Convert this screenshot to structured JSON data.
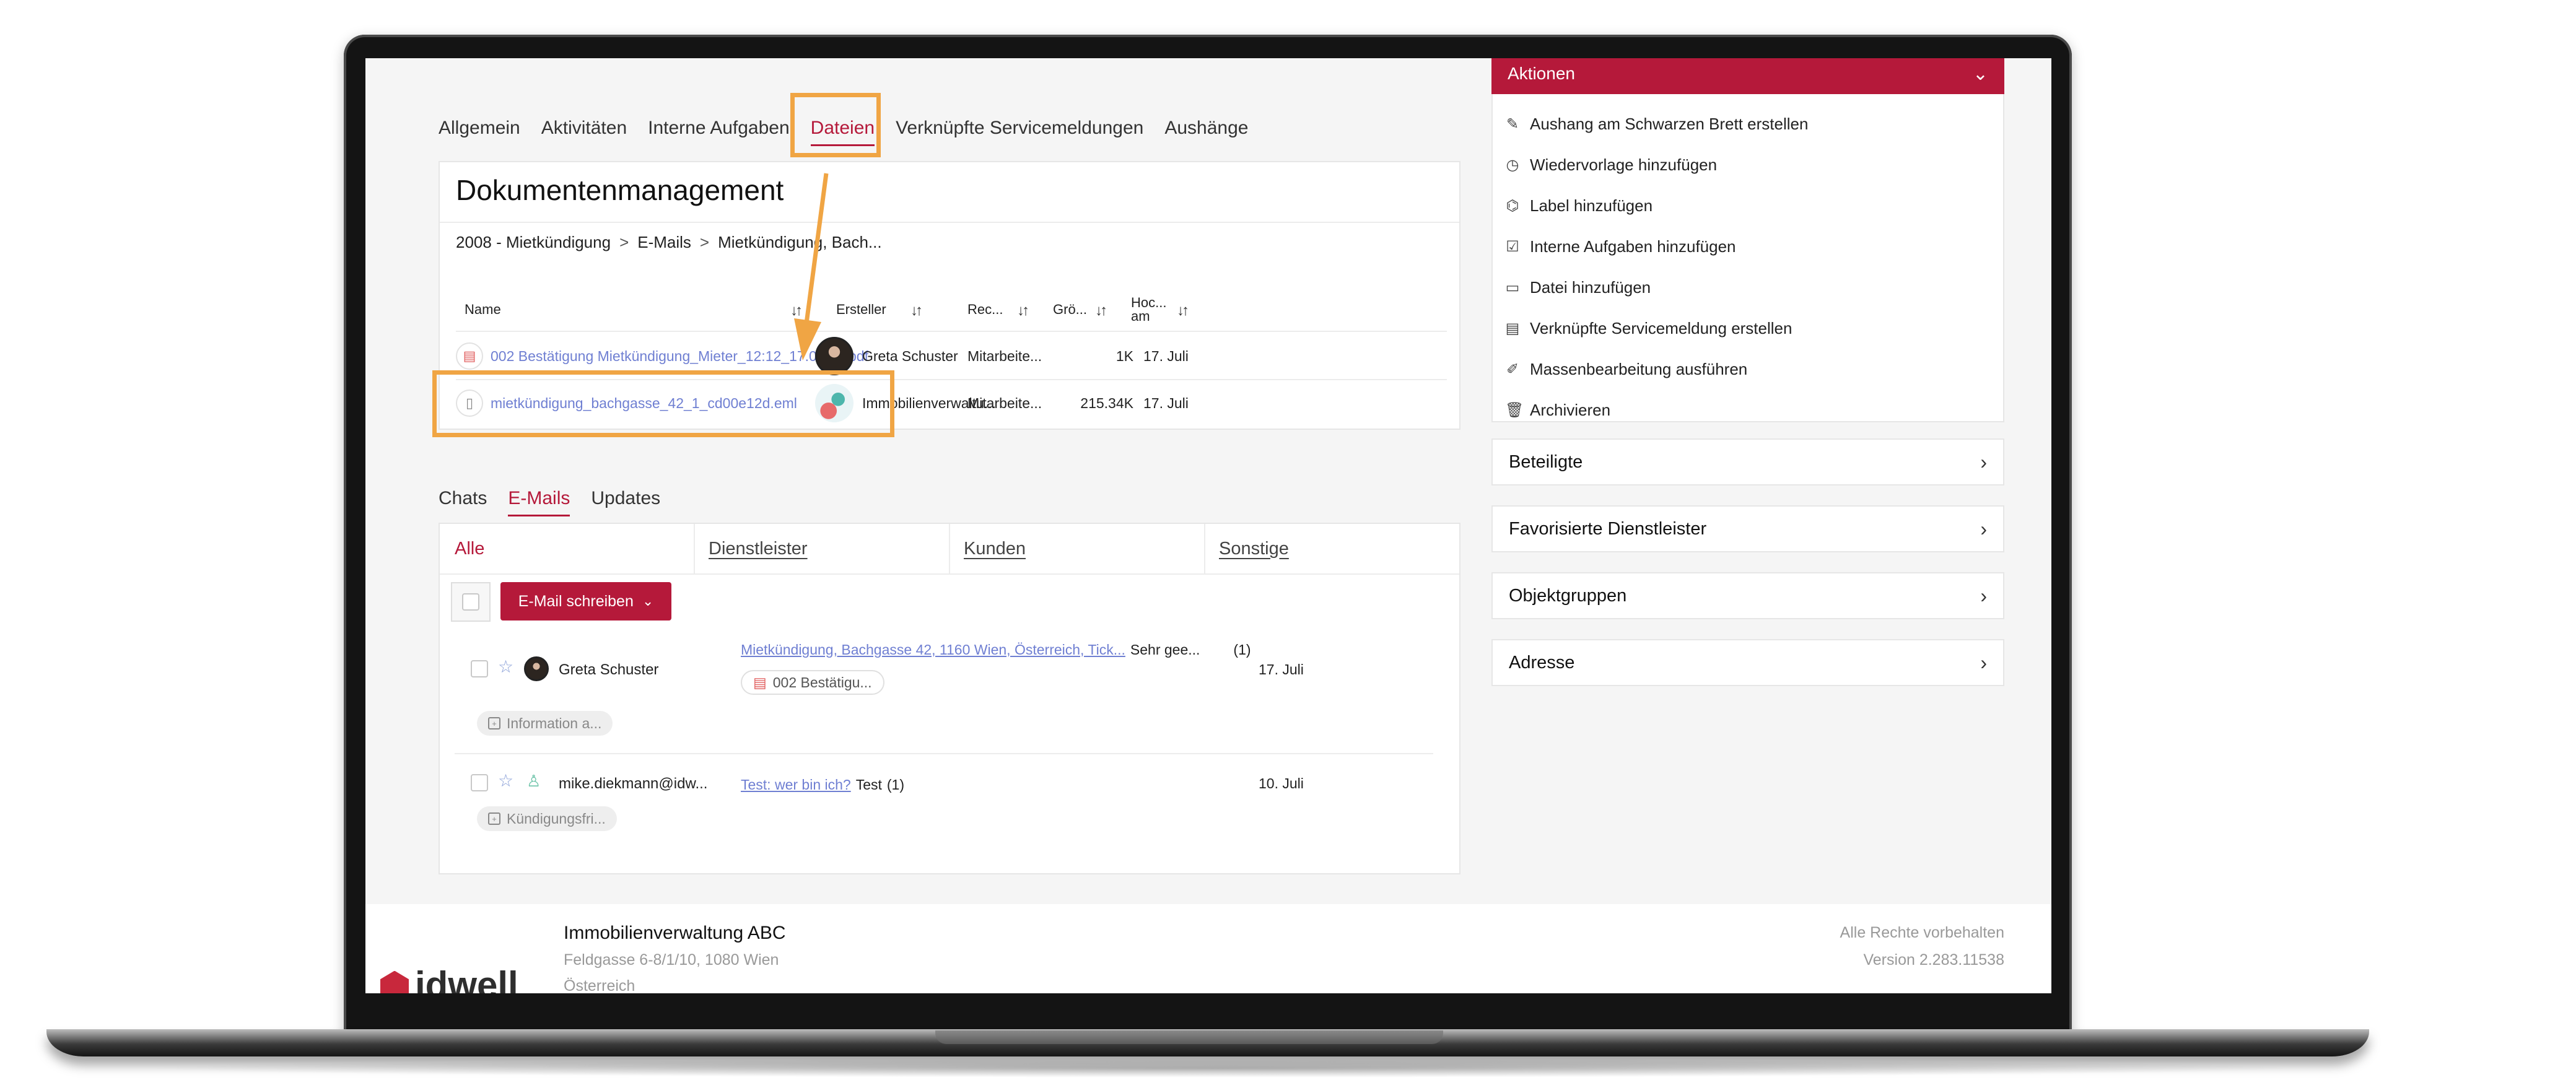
{
  "tabs": [
    "Allgemein",
    "Aktivitäten",
    "Interne Aufgaben",
    "Dateien",
    "Verknüpfte Servicemeldungen",
    "Aushänge"
  ],
  "active_tab": "Dateien",
  "documents": {
    "title": "Dokumentenmanagement",
    "breadcrumbs": [
      "2008 - Mietkündigung",
      "E-Mails",
      "Mietkündigung, Bach..."
    ],
    "breadcrumb_sep": ">",
    "columns": {
      "name": "Name",
      "creator": "Ersteller",
      "rec": "Rec...",
      "size": "Grö...",
      "uploaded_line1": "Hoc...",
      "uploaded_line2": "am"
    },
    "sort_glyph": "↓↑",
    "files": [
      {
        "icon": "pdf-icon",
        "name": "002 Bestätigung Mietkündigung_Mieter_12:12_17.07.25.pdf",
        "creator": "Greta Schuster",
        "rec": "Mitarbeite...",
        "size": "1K",
        "date": "17. Juli"
      },
      {
        "icon": "email-file-icon",
        "name": "mietkündigung_bachgasse_42_1_cd00e12d.eml",
        "creator": "Immobilienverwaltu...",
        "rec": "Mitarbeite...",
        "size": "215.34K",
        "date": "17. Juli"
      }
    ]
  },
  "comm_tabs": [
    "Chats",
    "E-Mails",
    "Updates"
  ],
  "active_comm_tab": "E-Mails",
  "mail_filters": [
    "Alle",
    "Dienstleister",
    "Kunden",
    "Sonstige"
  ],
  "compose_label": "E-Mail schreiben",
  "emails": [
    {
      "sender": "Greta Schuster",
      "subject": "Mietkündigung, Bachgasse 42, 1160 Wien, Österreich, Tick...",
      "preview": "Sehr gee...",
      "count": "(1)",
      "date": "17. Juli",
      "attachment": "002 Bestätigu...",
      "tag": "Information a..."
    },
    {
      "sender": "mike.diekmann@idw...",
      "subject": "Test: wer bin ich?",
      "preview": "Test",
      "count": "(1)",
      "date": "10. Juli",
      "tag": "Kündigungsfri..."
    }
  ],
  "aktionen": {
    "title": "Aktionen",
    "items": [
      {
        "icon": "edit-note-icon",
        "label": "Aushang am Schwarzen Brett erstellen"
      },
      {
        "icon": "clock-icon",
        "label": "Wiedervorlage hinzufügen"
      },
      {
        "icon": "tag-icon",
        "label": "Label hinzufügen"
      },
      {
        "icon": "checkbox-icon",
        "label": "Interne Aufgaben hinzufügen"
      },
      {
        "icon": "folder-icon",
        "label": "Datei hinzufügen"
      },
      {
        "icon": "document-icon",
        "label": "Verknüpfte Servicemeldung erstellen"
      },
      {
        "icon": "pencil-icon",
        "label": "Massenbearbeitung ausführen"
      },
      {
        "icon": "trash-icon",
        "label": "Archivieren"
      }
    ]
  },
  "panels": [
    "Beteiligte",
    "Favorisierte Dienstleister",
    "Objektgruppen",
    "Adresse"
  ],
  "footer": {
    "company": "Immobilienverwaltung ABC",
    "address": "Feldgasse 6-8/1/10, 1080 Wien",
    "country": "Österreich",
    "rights": "Alle Rechte vorbehalten",
    "version": "Version 2.283.11538",
    "logo_text": "idwell"
  },
  "colors": {
    "accent": "#b5193a",
    "highlight": "#f0a544",
    "link": "#6f7fd2"
  }
}
